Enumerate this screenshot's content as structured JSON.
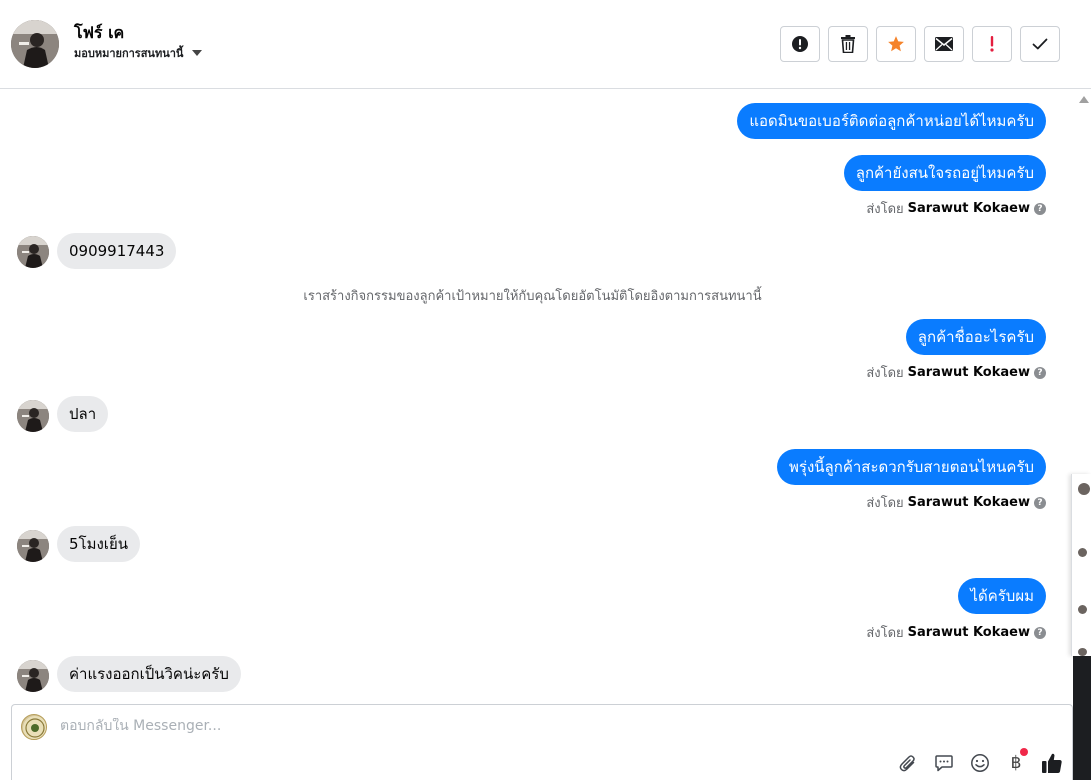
{
  "header": {
    "contact_name": "โฟร์ เค",
    "assign_label": "มอบหมายการสนทนานี้"
  },
  "actions": [
    {
      "name": "mark-spam-button",
      "icon": "alert-circle-icon"
    },
    {
      "name": "delete-button",
      "icon": "trash-icon"
    },
    {
      "name": "star-button",
      "icon": "star-icon"
    },
    {
      "name": "mark-unread-button",
      "icon": "envelope-icon"
    },
    {
      "name": "follow-up-button",
      "icon": "exclamation-icon"
    },
    {
      "name": "mark-done-button",
      "icon": "checkmark-icon"
    }
  ],
  "messages": {
    "m1": "แอดมินขอเบอร์ติดต่อลูกค้าหน่อยได้ไหมครับ",
    "m2": "ลูกค้ายังสนใจรถอยู่ไหมครับ",
    "m3": "0909917443",
    "system_note": "เราสร้างกิจกรรมของลูกค้าเป้าหมายให้กับคุณโดยอัตโนมัติโดยอิงตามการสนทนานี้",
    "m4": "ลูกค้าชื่ออะไรครับ",
    "m5": "ปลา",
    "m6": "พรุ่งนี้ลูกค้าสะดวกรับสายตอนไหนครับ",
    "m7": "5โมงเย็น",
    "m8": "ได้ครับผม",
    "m9": "ค่าแรงออกเป็นวิคน่ะครับ"
  },
  "sent_by": {
    "prefix": "ส่งโดย",
    "sender": "Sarawut Kokaew",
    "help": "?"
  },
  "composer": {
    "placeholder": "ตอบกลับใน Messenger..."
  },
  "tools": {
    "currency_symbol": "฿"
  },
  "colors": {
    "outgoing_bubble": "#0a7cff",
    "incoming_bubble": "#e9eaec",
    "star": "#f5832a",
    "follow_up": "#e41e3f",
    "notification_dot": "#f02849"
  }
}
